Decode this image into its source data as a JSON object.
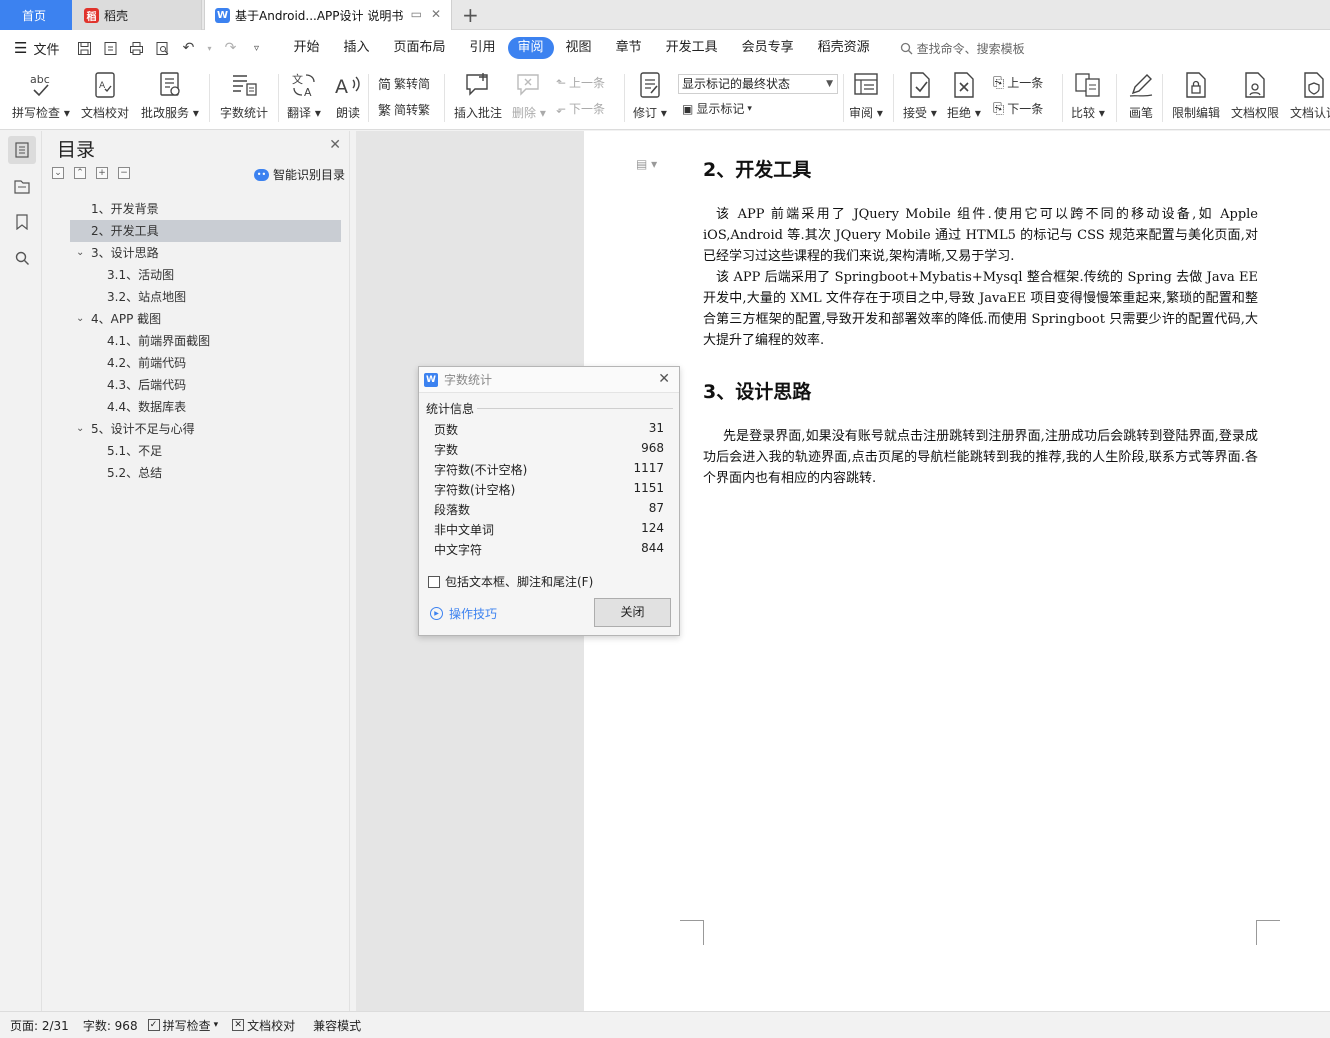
{
  "tabs": {
    "home": "首页",
    "daoke": "稻壳",
    "doc": "基于Android...APP设计 说明书",
    "add": "+"
  },
  "menu": {
    "file": "文件",
    "tabs": [
      "开始",
      "插入",
      "页面布局",
      "引用",
      "审阅",
      "视图",
      "章节",
      "开发工具",
      "会员专享",
      "稻壳资源"
    ],
    "active_tab": "审阅",
    "search": "查找命令、搜索模板"
  },
  "ribbon": {
    "spell_check": "拼写检查",
    "doc_proof": "文档校对",
    "correction_service": "批改服务",
    "word_count": "字数统计",
    "translate": "翻译",
    "read_aloud": "朗读",
    "trad_to_simp": "繁转简",
    "simp_to_trad": "简转繁",
    "insert_comment": "插入批注",
    "delete": "删除",
    "prev": "上一条",
    "next": "下一条",
    "track_changes": "修订",
    "markup_state": "显示标记的最终状态",
    "show_markup": "显示标记",
    "review": "审阅",
    "accept": "接受",
    "reject": "拒绝",
    "prev2": "上一条",
    "next2": "下一条",
    "compare": "比较",
    "ink": "画笔",
    "restrict_edit": "限制编辑",
    "doc_permission": "文档权限",
    "doc_cert": "文档认证"
  },
  "toc": {
    "title": "目录",
    "smart": "智能识别目录",
    "items": [
      {
        "text": "1、开发背景",
        "level": 1,
        "expandable": false,
        "selected": false
      },
      {
        "text": "2、开发工具",
        "level": 1,
        "expandable": false,
        "selected": true
      },
      {
        "text": "3、设计思路",
        "level": 1,
        "expandable": true,
        "selected": false
      },
      {
        "text": "3.1、活动图",
        "level": 2,
        "expandable": false,
        "selected": false
      },
      {
        "text": "3.2、站点地图",
        "level": 2,
        "expandable": false,
        "selected": false
      },
      {
        "text": "4、APP 截图",
        "level": 1,
        "expandable": true,
        "selected": false
      },
      {
        "text": "4.1、前端界面截图",
        "level": 2,
        "expandable": false,
        "selected": false
      },
      {
        "text": "4.2、前端代码",
        "level": 2,
        "expandable": false,
        "selected": false
      },
      {
        "text": "4.3、后端代码",
        "level": 2,
        "expandable": false,
        "selected": false
      },
      {
        "text": "4.4、数据库表",
        "level": 2,
        "expandable": false,
        "selected": false
      },
      {
        "text": "5、设计不足与心得",
        "level": 1,
        "expandable": true,
        "selected": false
      },
      {
        "text": "5.1、不足",
        "level": 2,
        "expandable": false,
        "selected": false
      },
      {
        "text": "5.2、总结",
        "level": 2,
        "expandable": false,
        "selected": false
      }
    ]
  },
  "document": {
    "heading1": "2、开发工具",
    "para1": "该 APP 前端采用了 JQuery Mobile 组件.使用它可以跨不同的移动设备,如 Apple iOS,Android 等.其次 JQuery Mobile 通过 HTML5 的标记与 CSS 规范来配置与美化页面,对已经学习过这些课程的我们来说,架构清晰,又易于学习.",
    "para2": "该 APP 后端采用了 Springboot+Mybatis+Mysql 整合框架.传统的 Spring 去做 Java EE 开发中,大量的 XML 文件存在于项目之中,导致 JavaEE 项目变得慢慢笨重起来,繁琐的配置和整合第三方框架的配置,导致开发和部署效率的降低.而使用 Springboot 只需要少许的配置代码,大大提升了编程的效率.",
    "heading2": "3、设计思路",
    "para3": "先是登录界面,如果没有账号就点击注册跳转到注册界面,注册成功后会跳转到登陆界面,登录成功后会进入我的轨迹界面,点击页尾的导航栏能跳转到我的推荐,我的人生阶段,联系方式等界面.各个界面内也有相应的内容跳转."
  },
  "dialog": {
    "title": "字数统计",
    "section": "统计信息",
    "stats": [
      {
        "label": "页数",
        "value": "31"
      },
      {
        "label": "字数",
        "value": "968"
      },
      {
        "label": "字符数(不计空格)",
        "value": "1117"
      },
      {
        "label": "字符数(计空格)",
        "value": "1151"
      },
      {
        "label": "段落数",
        "value": "87"
      },
      {
        "label": "非中文单词",
        "value": "124"
      },
      {
        "label": "中文字符",
        "value": "844"
      }
    ],
    "include_label": "包括文本框、脚注和尾注(F)",
    "tips": "操作技巧",
    "close": "关闭"
  },
  "status": {
    "page": "页面: 2/31",
    "words": "字数: 968",
    "spell": "拼写检查",
    "proof": "文档校对",
    "compat": "兼容模式"
  },
  "colors": {
    "accent": "#3c82f0",
    "daoke_red": "#e0332c"
  }
}
